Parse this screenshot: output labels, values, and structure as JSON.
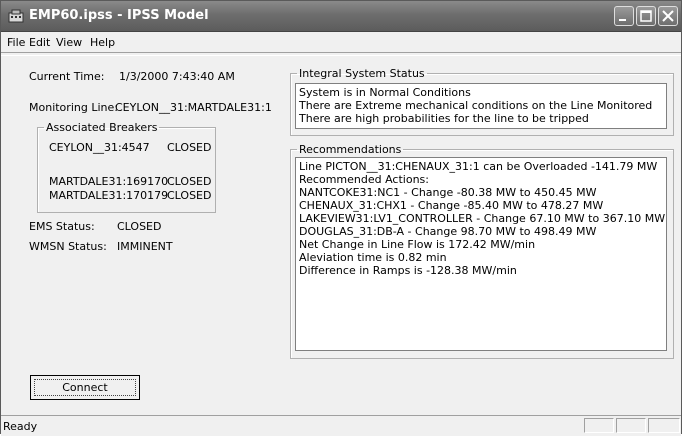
{
  "window": {
    "title": "EMP60.ipss - IPSS Model"
  },
  "menu": [
    "File",
    "Edit",
    "View",
    "Help"
  ],
  "left": {
    "current_time_label": "Current Time:",
    "current_time_value": "1/3/2000 7:43:40 AM",
    "monitoring_line_label": "Monitoring Line:",
    "monitoring_line_value": "CEYLON__31:MARTDALE31:1",
    "breakers_title": "Associated Breakers",
    "breakers": [
      {
        "name": "CEYLON__31:4547",
        "status": "CLOSED"
      },
      {
        "name": "MARTDALE31:169170",
        "status": "CLOSED"
      },
      {
        "name": "MARTDALE31:170179",
        "status": "CLOSED"
      }
    ],
    "ems_label": "EMS Status:",
    "ems_value": "CLOSED",
    "wmsn_label": "WMSN Status:",
    "wmsn_value": "IMMINENT"
  },
  "integral": {
    "title": "Integral System Status",
    "lines": [
      "System is in Normal Conditions",
      "There are Extreme mechanical conditions on the Line Monitored",
      "There are high probabilities for the line to be tripped"
    ]
  },
  "recommendations": {
    "title": "Recommendations",
    "lines": [
      "Line PICTON__31:CHENAUX_31:1 can be Overloaded -141.79 MW",
      "Recommended Actions:",
      "NANTCOKE31:NC1 - Change -80.38 MW to 450.45 MW",
      "CHENAUX_31:CHX1 - Change -85.40 MW to 478.27 MW",
      "LAKEVIEW31:LV1_CONTROLLER - Change 67.10 MW to 367.10 MW",
      "DOUGLAS_31:DB-A - Change 98.70 MW to 498.49 MW",
      "Net Change in Line Flow is 172.42 MW/min",
      "Aleviation time is 0.82 min",
      "Difference in Ramps is -128.38 MW/min"
    ]
  },
  "connect_label": "Connect",
  "status": "Ready"
}
